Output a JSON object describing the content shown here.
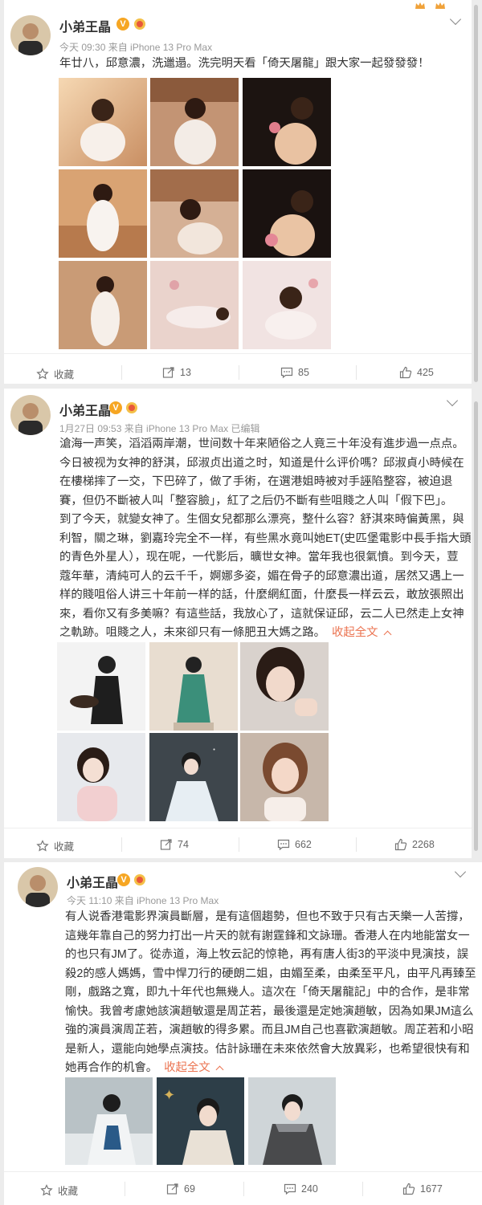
{
  "posts": [
    {
      "user": "小弟王晶",
      "meta": "今天 09:30 来自 iPhone 13 Pro Max",
      "lines": [
        "年廿八，邱意濃，洗邋遢。洗完明天看「倚天屠龍」跟大家一起發發發！"
      ],
      "collapse_label": "",
      "actions": {
        "favorite": "收藏",
        "repost": "13",
        "comment": "85",
        "like": "425"
      }
    },
    {
      "user": "小弟王晶",
      "meta": "1月27日 09:53 来自 iPhone 13 Pro Max   已编辑",
      "lines": [
        "滄海一声笑，滔滔兩岸潮，世间数十年来陋俗之人竟三十年没有進步過一点点。",
        "今日被视为女神的舒淇，邱淑贞出道之时，知道是什么评价嗎？邱淑貞小時候在",
        "在樓梯摔了一交，下巴碎了，做了手術，在選港姐時被对手誣陷整容，被迫退",
        "賽，但仍不斷被人叫「整容臉」，紅了之后仍不斷有些咀賤之人叫「假下巴」。",
        "到了今天，就變女神了。生個女兒都那么漂亮，整什么容？舒淇來時偏黃黑，與",
        "利智，關之琳，劉嘉玲完全不一样，有些黑水竟叫她ET(史匹堡電影中長手指大頭",
        "的青色外星人），现在呢，一代影后，曠世女神。當年我也很氣憤。到今天，荳",
        "蔻年華，清純可人的云千千，婀娜多姿，媚在骨子的邱意濃出道，居然又遇上一",
        "样的賤咀俗人讲三十年前一样的話，什麼網紅面，什麼長一样云云，敢放張照出",
        "來，看你又有多美嘛？有這些話，我放心了，這就保证邱，云二人已然走上女神",
        "之軌跡。咀賤之人，未來卻只有一條肥丑大媽之路。"
      ],
      "collapse_label": "收起全文",
      "actions": {
        "favorite": "收藏",
        "repost": "74",
        "comment": "662",
        "like": "2268"
      }
    },
    {
      "user": "小弟王晶",
      "meta": "今天 11:10 来自 iPhone 13 Pro Max",
      "lines": [
        "有人说香港電影界演員斷層，是有這個趨勢，但也不致于只有古天樂一人苦撐，",
        "這幾年靠自己的努力打出一片天的就有謝霆鋒和文詠珊。香港人在内地能當女一",
        "的也只有JM了。從赤道，海上牧云記的惊艳，再有唐人街3的平淡中見演技，誤",
        "殺2的感人媽媽，雪中悍刀行的硬朗二姐，由媚至柔，由柔至平凡，由平凡再臻至",
        "剛，戲路之寬，即九十年代也無幾人。這次在「倚天屠龍記」中的合作，是非常",
        "愉快。我曾考慮她該演趙敏還是周芷若，最後還是定她演趙敏，因為如果JM這么",
        "強的演員演周芷若，演趙敏的得多累。而且JM自己也喜歡演趙敏。周芷若和小昭",
        "是新人，還能向她學点演技。估計詠珊在未來依然會大放異彩，也希望很快有和",
        "她再合作的机會。"
      ],
      "collapse_label": "收起全文",
      "actions": {
        "favorite": "收藏",
        "repost": "69",
        "comment": "240",
        "like": "1677"
      }
    }
  ],
  "icons": [
    "star-icon",
    "repost-icon",
    "comment-icon",
    "like-icon",
    "chevron-down-icon",
    "verified-icon",
    "medal-icon"
  ],
  "colors": {
    "accent": "#eb7350",
    "verified": "#f6a623",
    "meta": "#999999",
    "background": "#ececec"
  }
}
